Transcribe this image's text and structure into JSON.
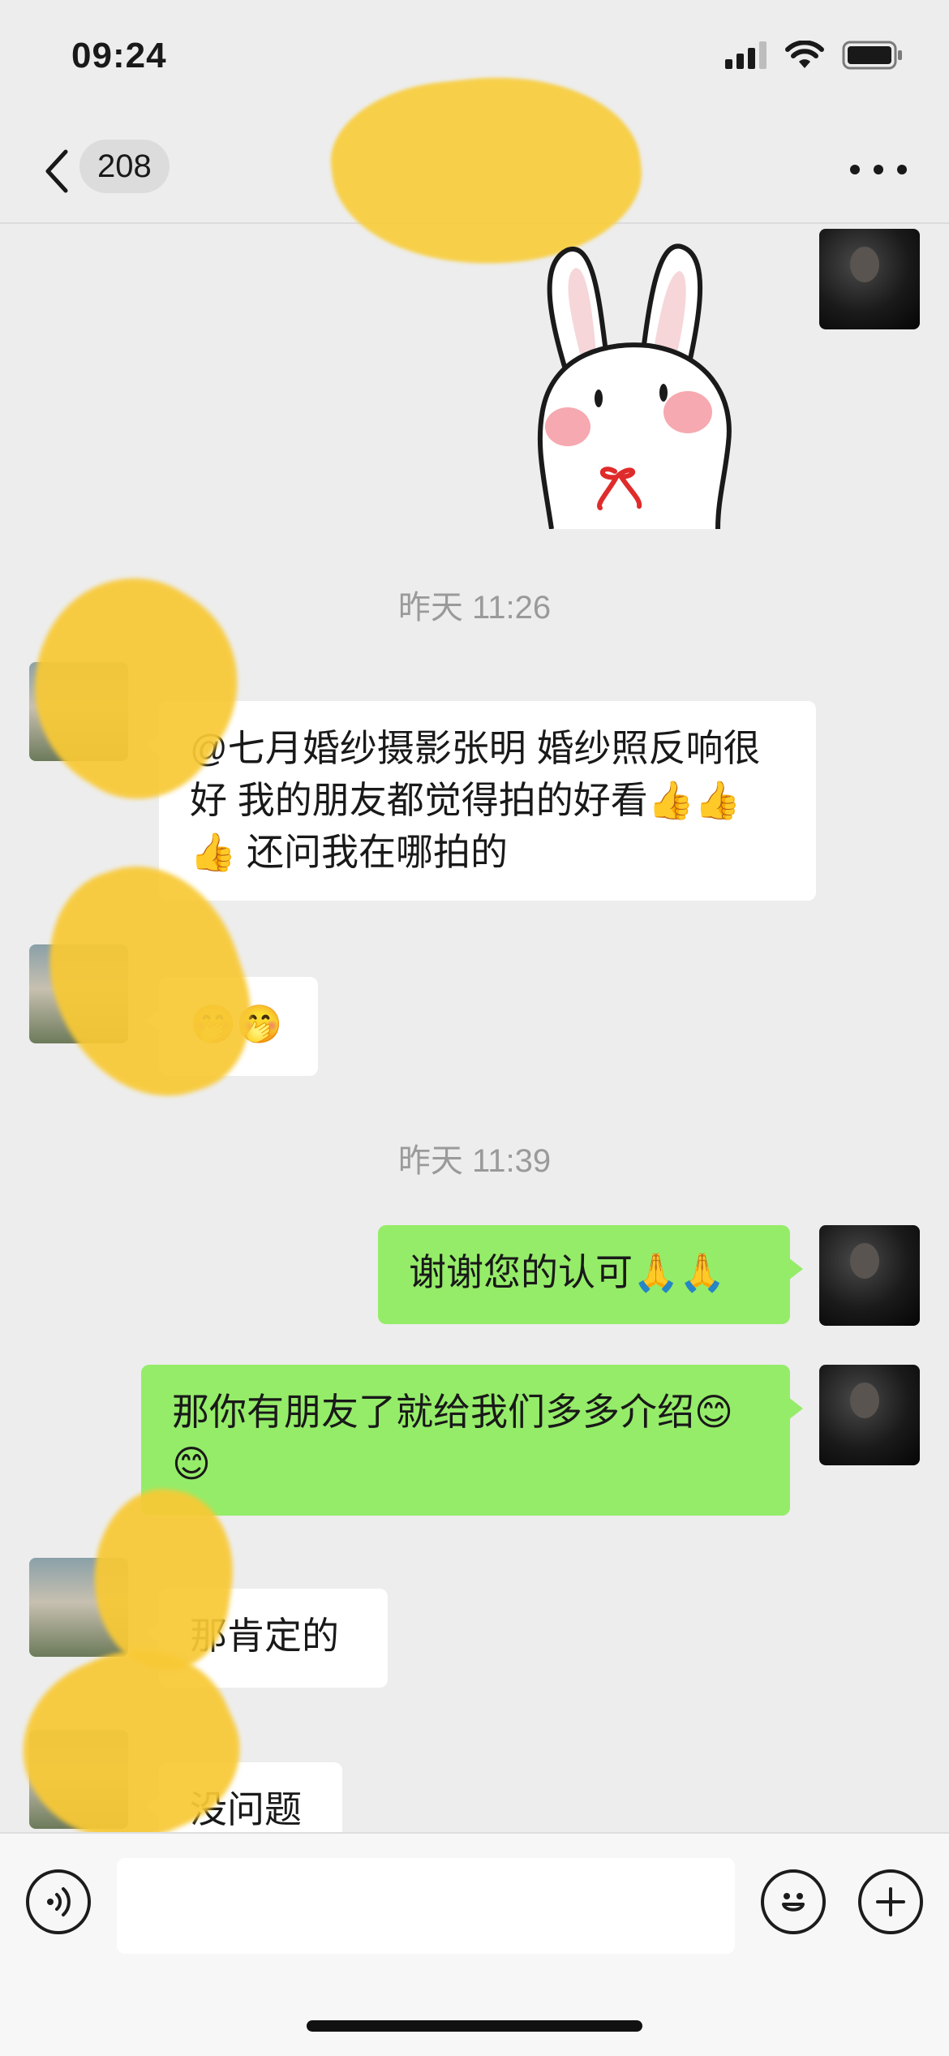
{
  "status_bar": {
    "time": "09:24",
    "icons": [
      "signal-icon",
      "wifi-icon",
      "battery-icon"
    ]
  },
  "nav": {
    "unread_count": "208",
    "icons": [
      "back-chevron-icon",
      "more-icon"
    ]
  },
  "messages": [
    {
      "type": "sticker",
      "side": "right",
      "description": "rabbit sticker"
    },
    {
      "type": "timestamp",
      "text": "昨天 11:26"
    },
    {
      "type": "text",
      "side": "left",
      "text": "@七月婚纱摄影张明 婚纱照反响很好  我的朋友都觉得拍的好看👍👍👍  还问我在哪拍的"
    },
    {
      "type": "text",
      "side": "left",
      "text": "🤭🤭"
    },
    {
      "type": "timestamp",
      "text": "昨天 11:39"
    },
    {
      "type": "text",
      "side": "right",
      "text": "谢谢您的认可🙏🙏"
    },
    {
      "type": "text",
      "side": "right",
      "text": "那你有朋友了就给我们多多介绍😊😊"
    },
    {
      "type": "text",
      "side": "left",
      "text": "那肯定的"
    },
    {
      "type": "text",
      "side": "left",
      "text": "没问题"
    }
  ],
  "input_bar": {
    "value": "",
    "icons": [
      "voice-icon",
      "emoji-icon",
      "plus-icon"
    ]
  },
  "colors": {
    "background": "#ededed",
    "bubble_out": "#95ec69",
    "bubble_in": "#ffffff",
    "redaction": "#f8c935"
  }
}
